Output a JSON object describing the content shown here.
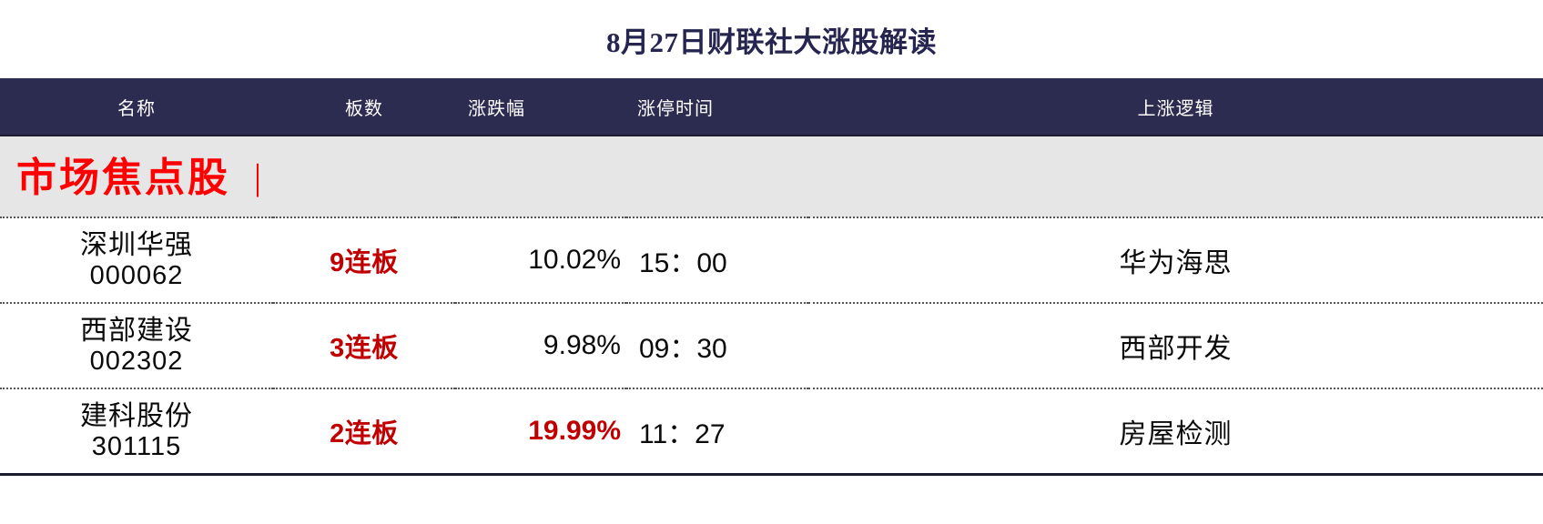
{
  "title": "8月27日财联社大涨股解读",
  "table": {
    "columns": [
      {
        "key": "name",
        "label": "名称"
      },
      {
        "key": "boards",
        "label": "板数"
      },
      {
        "key": "change",
        "label": "涨跌幅"
      },
      {
        "key": "time",
        "label": "涨停时间"
      },
      {
        "key": "logic",
        "label": "上涨逻辑"
      }
    ],
    "sections": [
      {
        "label": "市场焦点股",
        "divider": "|",
        "rows": [
          {
            "name": "深圳华强",
            "code": "000062",
            "boards": "9连板",
            "change": "10.02%",
            "change_highlight": false,
            "time": "15：00",
            "logic": "华为海思"
          },
          {
            "name": "西部建设",
            "code": "002302",
            "boards": "3连板",
            "change": "9.98%",
            "change_highlight": false,
            "time": "09：30",
            "logic": "西部开发"
          },
          {
            "name": "建科股份",
            "code": "301115",
            "boards": "2连板",
            "change": "19.99%",
            "change_highlight": true,
            "time": "11：27",
            "logic": "房屋检测"
          }
        ]
      }
    ]
  },
  "colors": {
    "header_bg": "#2C2B50",
    "title_text": "#262550",
    "section_bg": "#E6E6E6",
    "section_text": "#FF0000",
    "boards_text": "#C00000",
    "change_highlight": "#C00000",
    "body_text": "#0A0A0A"
  }
}
